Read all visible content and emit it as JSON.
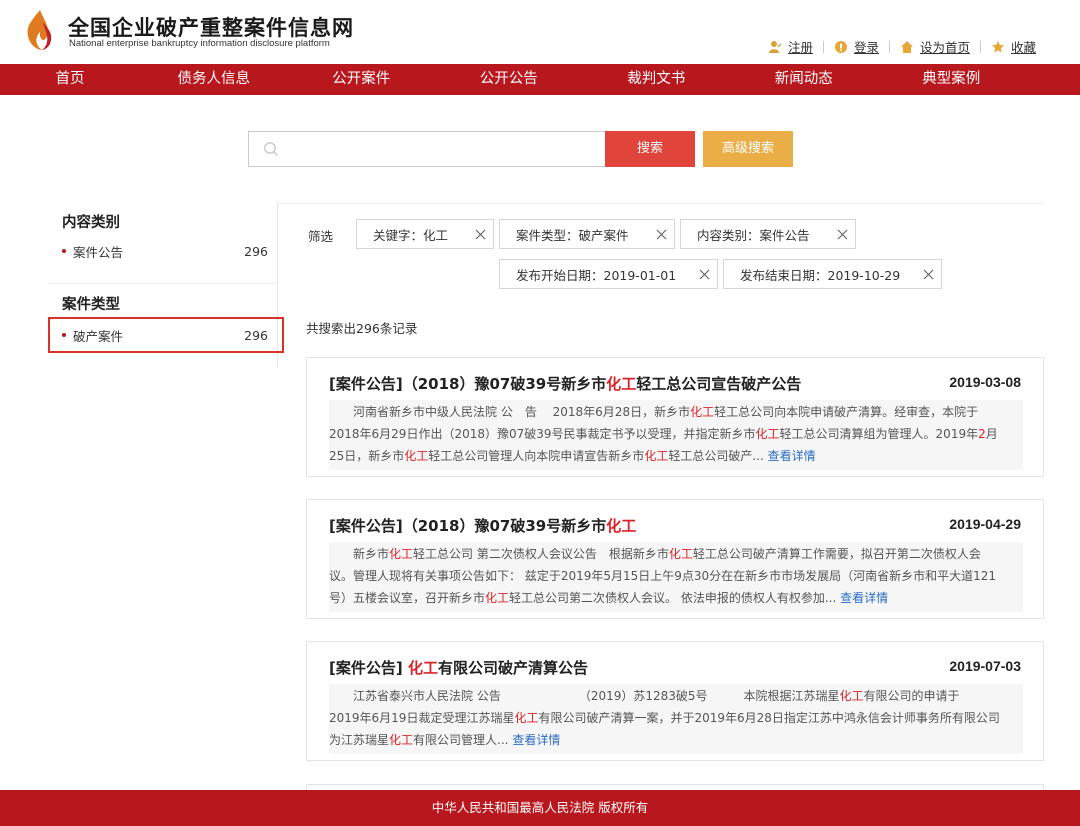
{
  "header": {
    "title": "全国企业破产重整案件信息网",
    "subtitle": "National enterprise bankruptcy  information disclosure platform",
    "links": [
      "注册",
      "登录",
      "设为首页",
      "收藏"
    ]
  },
  "nav": [
    "首页",
    "债务人信息",
    "公开案件",
    "公开公告",
    "裁判文书",
    "新闻动态",
    "典型案例"
  ],
  "search": {
    "placeholder": "",
    "search_label": "搜索",
    "advanced_label": "高级搜索"
  },
  "sidebar": {
    "content_heading": "内容类别",
    "content_items": [
      {
        "label": "案件公告",
        "count": "296"
      }
    ],
    "case_heading": "案件类型",
    "case_items": [
      {
        "label": "破产案件",
        "count": "296"
      }
    ]
  },
  "filters": {
    "label": "筛选",
    "chips": [
      "关键字：化工",
      "案件类型：破产案件",
      "内容类别：案件公告",
      "发布开始日期：2019-01-01",
      "发布结束日期：2019-10-29"
    ]
  },
  "result_count": "共搜索出296条记录",
  "more_label": "查看详情",
  "results": [
    {
      "tag": "[案件公告]",
      "title_pre": "（2018）豫07破39号新乡市",
      "title_hl": "化工",
      "title_post": "轻工总公司宣告破产公告",
      "date": "2019-03-08",
      "line1": [
        {
          "t": "　　河南省新乡市中级人民法院 公　告　 2018年6月28日，新乡市",
          "h": false
        },
        {
          "t": "化工",
          "h": true
        },
        {
          "t": "轻工总公司向本院申请破产清算。经审查，本院于",
          "h": false
        }
      ],
      "line2": [
        {
          "t": "2018年6月29日作出（2018）豫07破39号民事裁定书予以受理，并指定新乡市",
          "h": false
        },
        {
          "t": "化工",
          "h": true
        },
        {
          "t": "轻工总公司清算组为管理人。2019年",
          "h": false
        },
        {
          "t": "2",
          "h": true
        },
        {
          "t": "月",
          "h": false
        }
      ],
      "line3": [
        {
          "t": "25日，新乡市",
          "h": false
        },
        {
          "t": "化工",
          "h": true
        },
        {
          "t": "轻工总公司管理人向本院申请宣告新乡市",
          "h": false
        },
        {
          "t": "化工",
          "h": true
        },
        {
          "t": "轻工总公司破产...",
          "h": false
        }
      ]
    },
    {
      "tag": "[案件公告]",
      "title_pre": "（2018）豫07破39号新乡市",
      "title_hl": "化工",
      "title_post": "",
      "date": "2019-04-29",
      "line1": [
        {
          "t": "　　新乡市",
          "h": false
        },
        {
          "t": "化工",
          "h": true
        },
        {
          "t": "轻工总公司 第二次债权人会议公告　根据新乡市",
          "h": false
        },
        {
          "t": "化工",
          "h": true
        },
        {
          "t": "轻工总公司破产清算工作需要，拟召开第二次债权人会",
          "h": false
        }
      ],
      "line2": [
        {
          "t": "议。管理人现将有关事项公告如下：  兹定于2019年5月15日上午9点30分在在新乡市市场发展局（河南省新乡市和平大道121",
          "h": false
        }
      ],
      "line3": [
        {
          "t": "号）五楼会议室，召开新乡市",
          "h": false
        },
        {
          "t": "化工",
          "h": true
        },
        {
          "t": "轻工总公司第二次债权人会议。 依法申报的债权人有权参加...",
          "h": false
        }
      ]
    },
    {
      "tag": "[案件公告]",
      "title_pre": " ",
      "title_hl": "化工",
      "title_post": "有限公司破产清算公告",
      "date": "2019-07-03",
      "line1": [
        {
          "t": "　　江苏省泰兴市人民法院 公告　　　　　　　（2019）苏1283破5号　　　本院根据江苏瑞星",
          "h": false
        },
        {
          "t": "化工",
          "h": true
        },
        {
          "t": "有限公司的申请于",
          "h": false
        }
      ],
      "line2": [
        {
          "t": "2019年6月19日裁定受理江苏瑞星",
          "h": false
        },
        {
          "t": "化工",
          "h": true
        },
        {
          "t": "有限公司破产清算一案，并于2019年6月28日指定江苏中鸿永信会计师事务所有限公司",
          "h": false
        }
      ],
      "line3": [
        {
          "t": "为江苏瑞星",
          "h": false
        },
        {
          "t": "化工",
          "h": true
        },
        {
          "t": "有限公司管理人...",
          "h": false
        }
      ]
    }
  ],
  "footer": "中华人民共和国最高人民法院 版权所有",
  "colors": {
    "brand_red": "#b7171d",
    "search_red": "#e0443a",
    "advanced_orange": "#ebae47",
    "highlight": "#d9232a",
    "link_blue": "#2a6cc4"
  }
}
